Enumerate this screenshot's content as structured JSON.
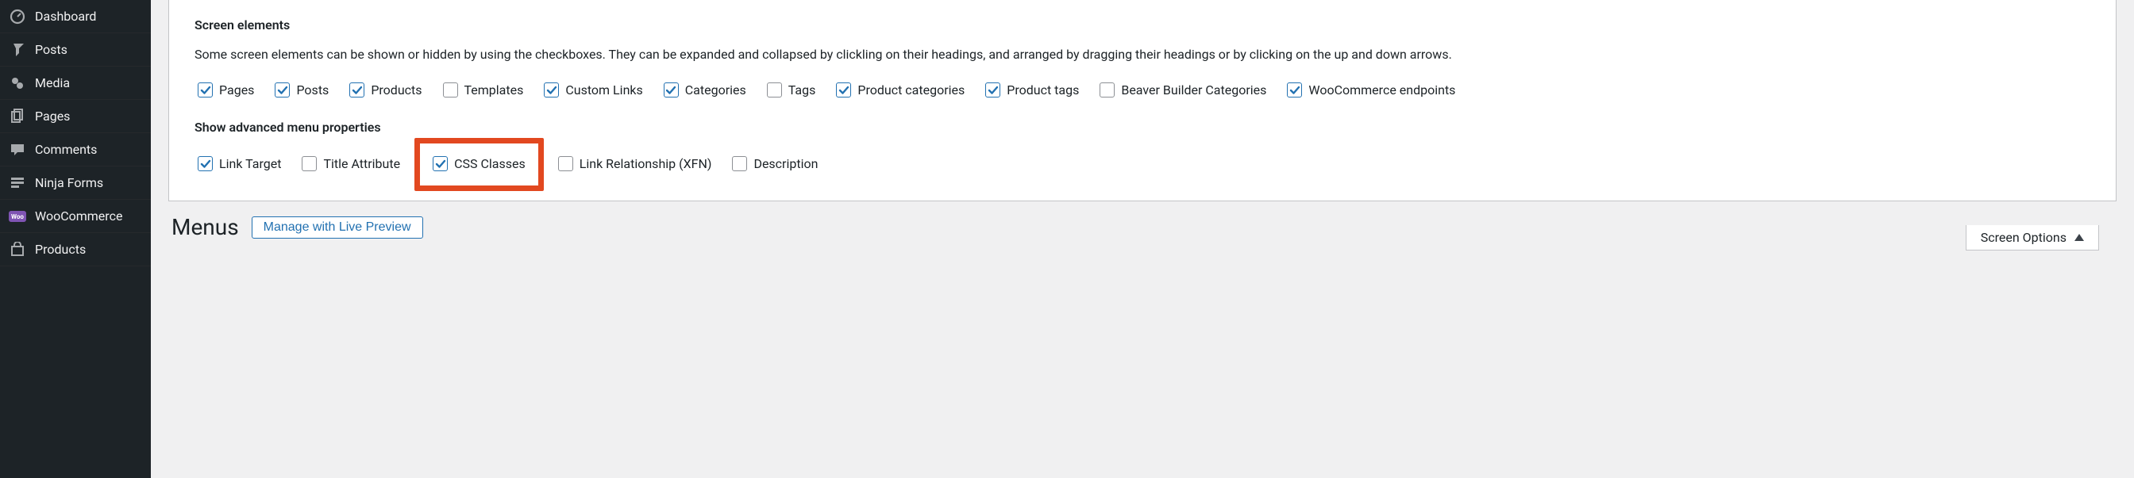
{
  "sidebar": {
    "items": [
      {
        "label": "Dashboard"
      },
      {
        "label": "Posts"
      },
      {
        "label": "Media"
      },
      {
        "label": "Pages"
      },
      {
        "label": "Comments"
      },
      {
        "label": "Ninja Forms"
      },
      {
        "label": "WooCommerce"
      },
      {
        "label": "Products"
      }
    ]
  },
  "screen_options": {
    "elements_heading": "Screen elements",
    "elements_desc": "Some screen elements can be shown or hidden by using the checkboxes. They can be expanded and collapsed by clickling on their headings, and arranged by dragging their headings or by clicking on the up and down arrows.",
    "elements": [
      {
        "label": "Pages",
        "checked": true
      },
      {
        "label": "Posts",
        "checked": true
      },
      {
        "label": "Products",
        "checked": true
      },
      {
        "label": "Templates",
        "checked": false
      },
      {
        "label": "Custom Links",
        "checked": true
      },
      {
        "label": "Categories",
        "checked": true
      },
      {
        "label": "Tags",
        "checked": false
      },
      {
        "label": "Product categories",
        "checked": true
      },
      {
        "label": "Product tags",
        "checked": true
      },
      {
        "label": "Beaver Builder Categories",
        "checked": false
      },
      {
        "label": "WooCommerce endpoints",
        "checked": true
      }
    ],
    "advanced_heading": "Show advanced menu properties",
    "advanced": [
      {
        "label": "Link Target",
        "checked": true
      },
      {
        "label": "Title Attribute",
        "checked": false
      },
      {
        "label": "CSS Classes",
        "checked": true,
        "highlight": true
      },
      {
        "label": "Link Relationship (XFN)",
        "checked": false
      },
      {
        "label": "Description",
        "checked": false
      }
    ],
    "tab_label": "Screen Options"
  },
  "page": {
    "title": "Menus",
    "preview_button": "Manage with Live Preview"
  }
}
